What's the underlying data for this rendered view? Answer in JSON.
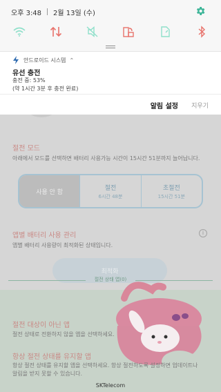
{
  "status_bar": {
    "time": "오후 3:48",
    "date": "2월 13일 (수)"
  },
  "quick_settings": [
    {
      "name": "wifi-icon",
      "state": "off"
    },
    {
      "name": "data-transfer-icon",
      "state": "on"
    },
    {
      "name": "sound-mute-icon",
      "state": "off"
    },
    {
      "name": "screen-rotation-icon",
      "state": "on"
    },
    {
      "name": "document-icon",
      "state": "off"
    },
    {
      "name": "bluetooth-icon",
      "state": "on"
    }
  ],
  "colors": {
    "accent_red": "#e8726b",
    "icon_inactive": "#7ddcc3",
    "gear": "#3db598"
  },
  "notification": {
    "app_name": "안드로이드 시스템",
    "title": "유선 충전",
    "line1": "충전 중: 53%",
    "line2": "(약 1시간 3분 후 충전 완료)"
  },
  "actions": {
    "alarm_settings": "알림 설정",
    "clear": "지우기"
  },
  "app": {
    "mode_title": "절전 모드",
    "mode_desc": "아래에서 모드를 선택하면 배터리 사용가능 시간이 15시간 51분까지 늘어납니다.",
    "modes": [
      {
        "main": "사용 안 함",
        "sub": ""
      },
      {
        "main": "절전",
        "sub": "6시간 48분"
      },
      {
        "main": "초절전",
        "sub": "15시간 51분"
      }
    ],
    "app_battery_title": "앱별 배터리 사용 관리",
    "app_battery_desc": "앱별 배터리 사용량이 최적화된 상태입니다.",
    "optimize_button": "최적화",
    "divider_label": "절전 상태 앱(0)",
    "unmonitored_title": "절전 대상이 아닌 앱",
    "unmonitored_desc": "절전 상태로 전환하지 않을 앱을 선택하세요.",
    "always_sleep_title": "항상 절전 상태를 유지할 앱",
    "always_sleep_desc1": "항상 절전 상태를 유지할 앱을 선택하세요. 항상 절전하도록 설정하면 업데이트나",
    "always_sleep_desc2": "알림을 받지 못할 수 있습니다."
  },
  "carrier": "SKTelecom"
}
